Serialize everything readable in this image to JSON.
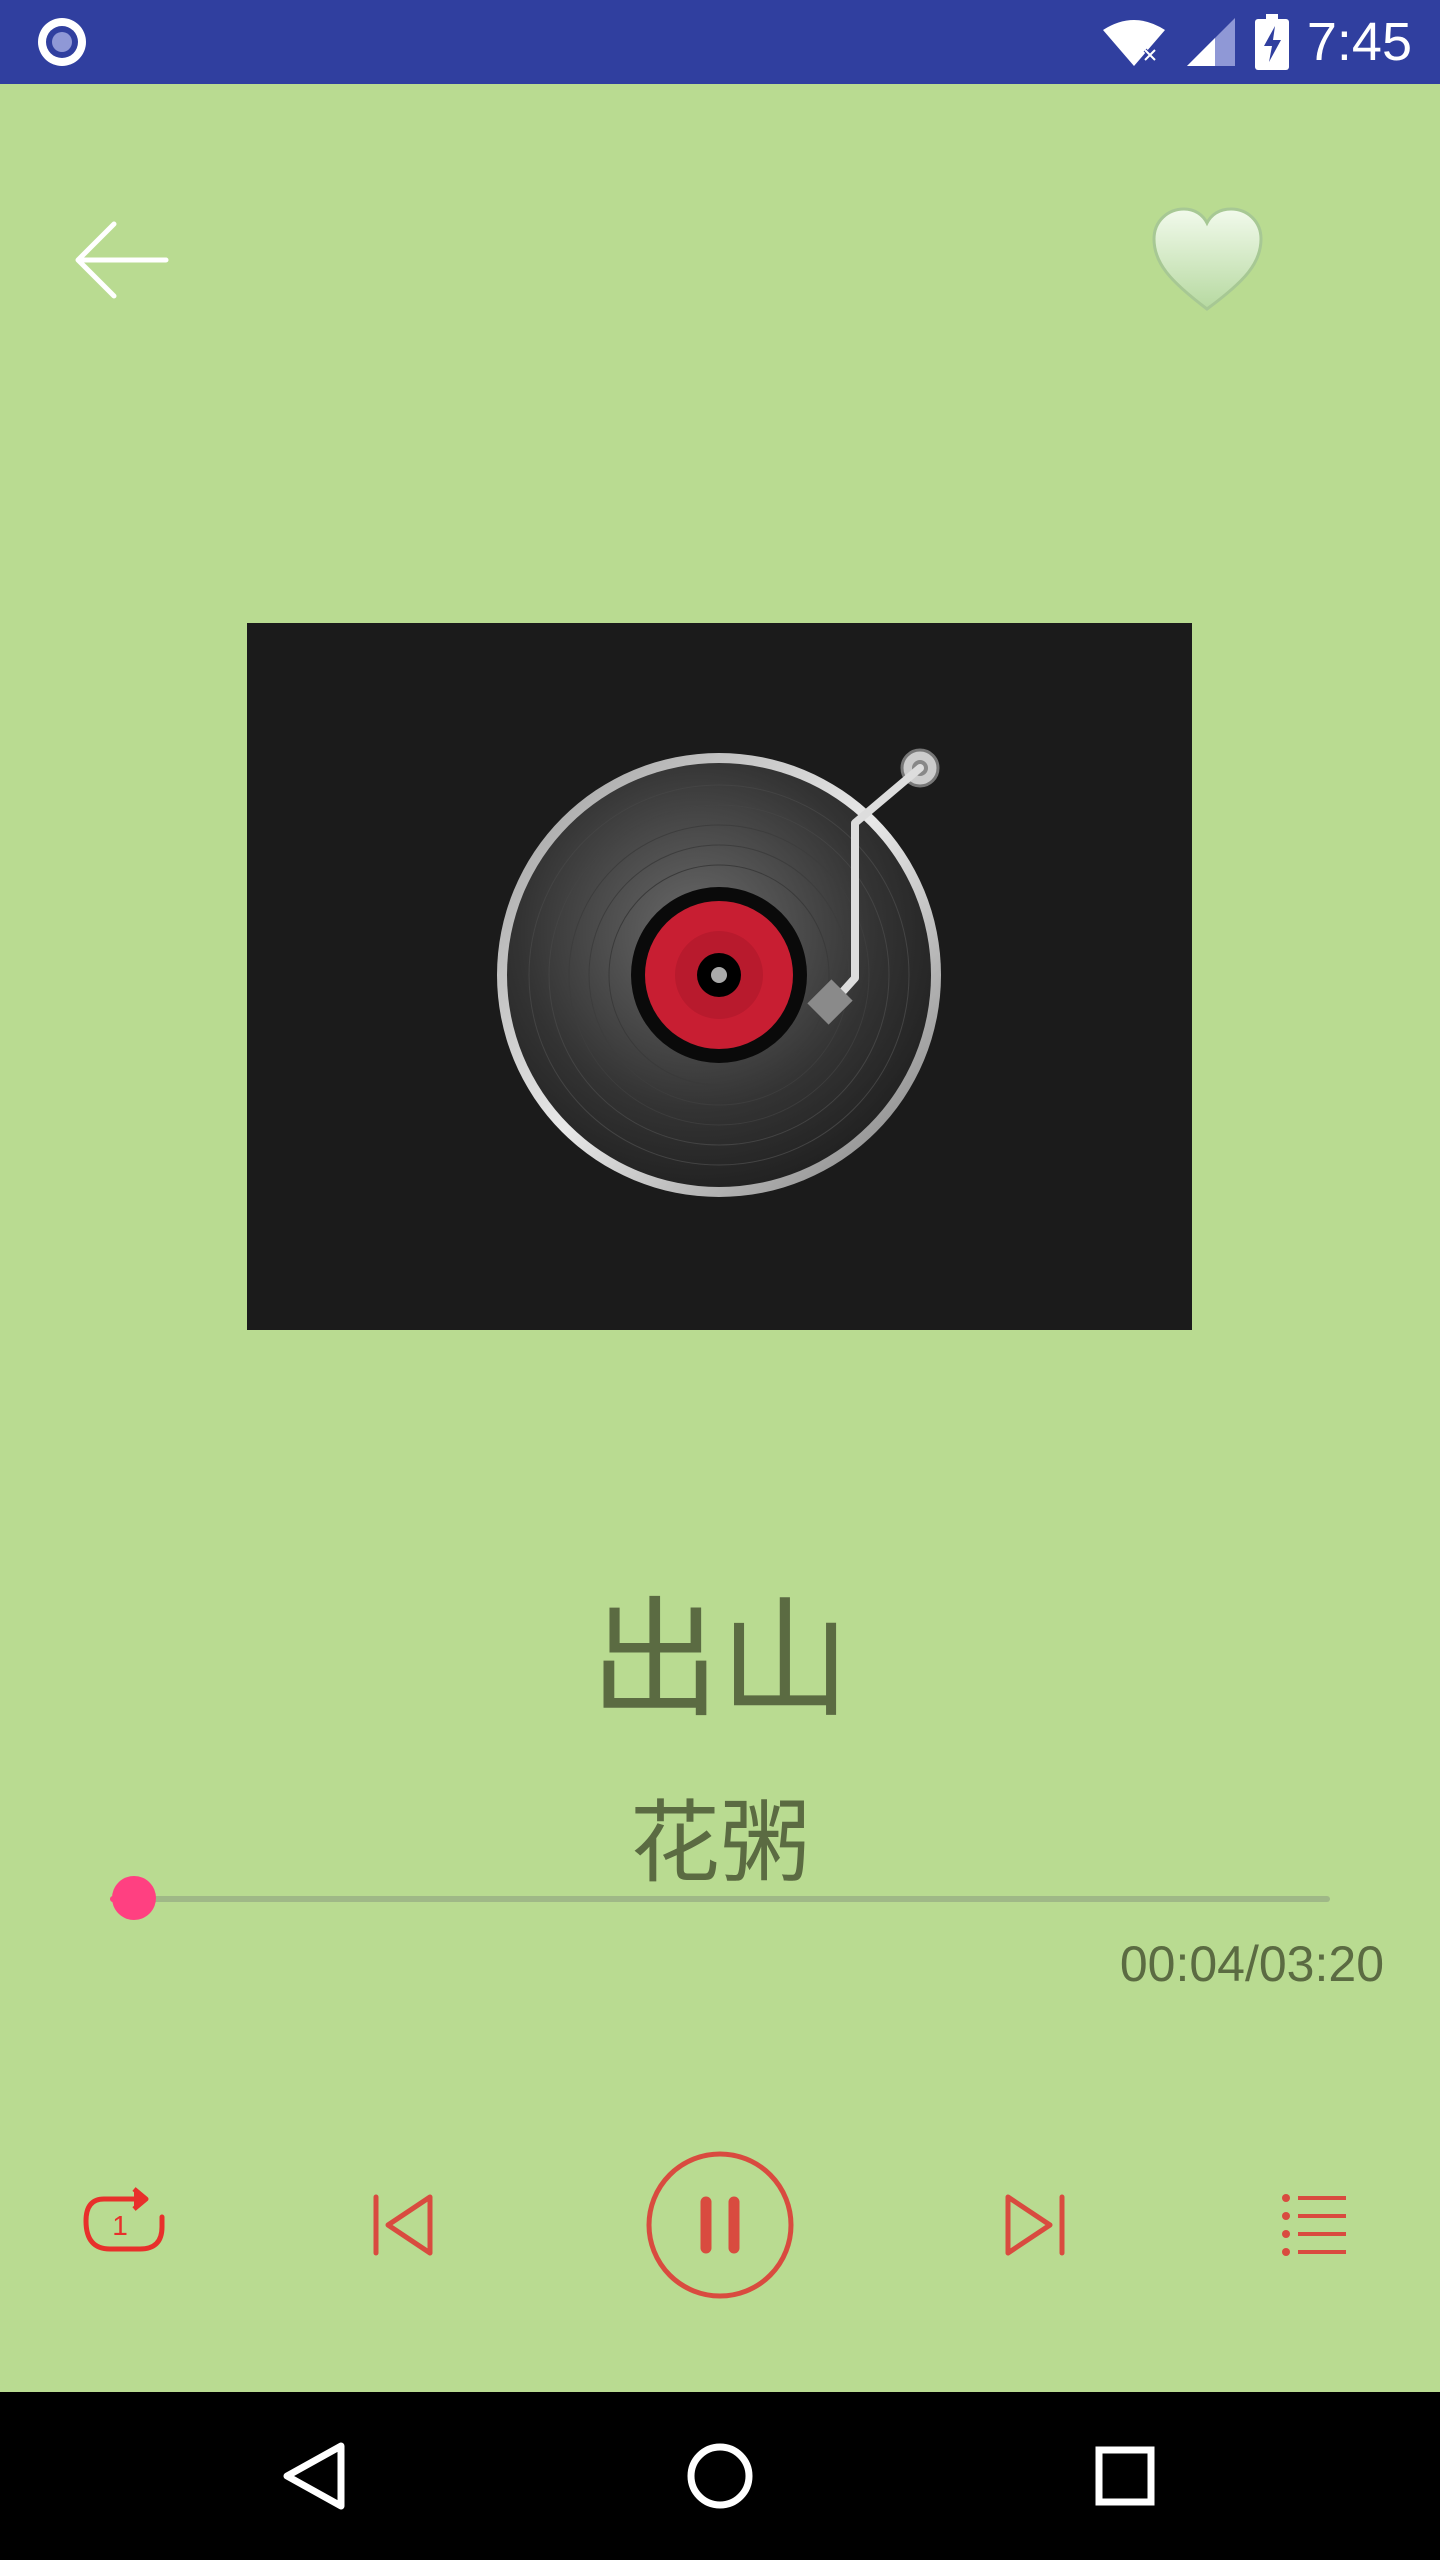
{
  "status_bar": {
    "time": "7:45",
    "icons": [
      "app-notification-icon",
      "wifi-icon",
      "signal-icon",
      "battery-charging-icon"
    ]
  },
  "header": {
    "back_icon": "arrow-left-icon",
    "favorite_icon": "heart-icon"
  },
  "player": {
    "song_title": "出山",
    "artist": "花粥",
    "elapsed": "00:04",
    "duration": "03:20",
    "time_readout": "00:04/03:20",
    "progress_fraction": 0.02
  },
  "controls": {
    "repeat_mode_number": "1",
    "icons": [
      "repeat-one-icon",
      "skip-previous-icon",
      "pause-icon",
      "skip-next-icon",
      "playlist-icon"
    ]
  },
  "colors": {
    "background": "#b9db91",
    "status_bar": "#303f9f",
    "accent": "#ff4081",
    "control_red": "#d94b3f",
    "text": "#5b6b42"
  }
}
